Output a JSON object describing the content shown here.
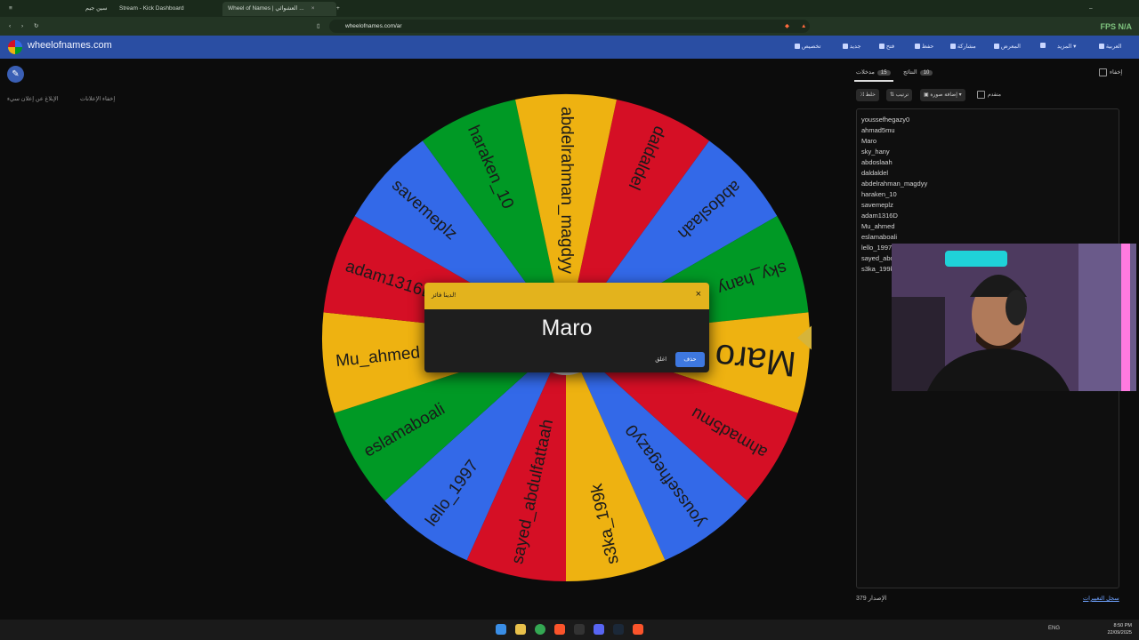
{
  "browser": {
    "tabs": [
      {
        "label": "سين جيم",
        "active": false
      },
      {
        "label": "Stream - Kick Dashboard",
        "active": false
      },
      {
        "label": "Wheel of Names | العشوائي ...",
        "active": true
      }
    ],
    "url": "wheelofnames.com/ar",
    "fps": "FPS N/A"
  },
  "app": {
    "brand": "wheelofnames.com",
    "nav": [
      "تخصيص",
      "جديد",
      "فتح",
      "حفظ",
      "مشاركة",
      "المعرض",
      "المزيد",
      "العربية"
    ]
  },
  "left_ads": {
    "report": "الإبلاغ عن إعلان سيء",
    "hide": "إخفاء الإعلانات"
  },
  "wheel": {
    "slices": [
      {
        "label": "daldaldel",
        "color": "#d50f25"
      },
      {
        "label": "abdoslaah",
        "color": "#3369e8"
      },
      {
        "label": "sky_hany",
        "color": "#009925"
      },
      {
        "label": "Maro",
        "color": "#eeb211"
      },
      {
        "label": "ahmad5mu",
        "color": "#d50f25"
      },
      {
        "label": "youssefhegazy0",
        "color": "#3369e8"
      },
      {
        "label": "s3ka_199k",
        "color": "#eeb211"
      },
      {
        "label": "sayed_abdulfattaah",
        "color": "#d50f25"
      },
      {
        "label": "lello_1997",
        "color": "#3369e8"
      },
      {
        "label": "eslamaboali",
        "color": "#009925"
      },
      {
        "label": "Mu_ahmed",
        "color": "#eeb211"
      },
      {
        "label": "adam1316D",
        "color": "#d50f25"
      },
      {
        "label": "savemeplz",
        "color": "#3369e8"
      },
      {
        "label": "haraken_10",
        "color": "#009925"
      },
      {
        "label": "abdelrahman_magdyy",
        "color": "#eeb211"
      }
    ]
  },
  "dialog": {
    "title": "لدينا فائز!",
    "winner": "Maro",
    "close_label": "اغلق",
    "remove_label": "حذف"
  },
  "sidebar": {
    "hide_label": "إخفاء",
    "results_tab": "النتائج",
    "results_count": "10",
    "entries_tab": "مدخلات",
    "entries_count": "15",
    "shuffle": "خلط",
    "sort": "ترتيب",
    "add_image": "إضافة صورة",
    "advanced": "متقدم",
    "entries": [
      "youssefhegazy0",
      "ahmad5mu",
      "Maro",
      "sky_hany",
      "abdoslaah",
      "daldaldel",
      "abdelrahman_magdyy",
      "haraken_10",
      "savemeplz",
      "adam1316D",
      "Mu_ahmed",
      "eslamaboali",
      "lello_1997",
      "sayed_abdulfattaah",
      "s3ka_199k"
    ],
    "version": "الإصدار 379",
    "changelog": "سجل التغييرات"
  },
  "taskbar": {
    "lang": "ENG",
    "time": "8:50 PM",
    "date": "22/09/2025"
  }
}
